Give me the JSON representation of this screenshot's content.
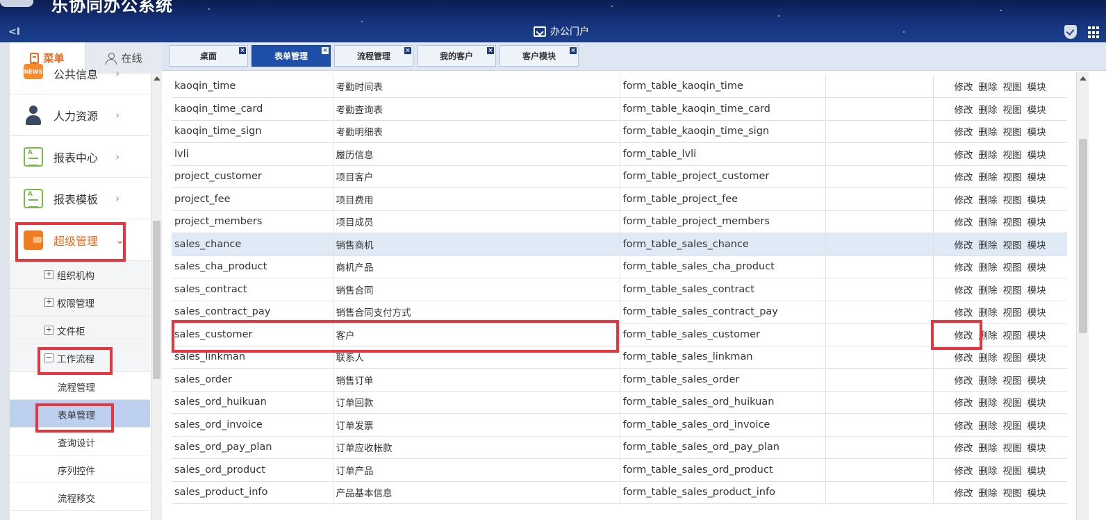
{
  "header": {
    "app_title": "乐协同办公系统",
    "portal_label": "办公门户",
    "collapse_glyph": "<I"
  },
  "sidebar": {
    "tabs": [
      {
        "label": "菜单",
        "icon": "document-icon",
        "active": true
      },
      {
        "label": "在线",
        "icon": "user-icon",
        "active": false
      }
    ],
    "menu_items": [
      {
        "label": "公共信息",
        "icon": "news-icon",
        "icon_text": "NEWS"
      },
      {
        "label": "人力资源",
        "icon": "person-icon"
      },
      {
        "label": "报表中心",
        "icon": "report-icon"
      },
      {
        "label": "报表模板",
        "icon": "report-icon"
      },
      {
        "label": "超级管理",
        "icon": "wallet-icon",
        "active": true
      }
    ],
    "chevron_right": "›",
    "chevron_down": "⌄",
    "sub_items": [
      {
        "label": "组织机构",
        "toggle": "+"
      },
      {
        "label": "权限管理",
        "toggle": "+"
      },
      {
        "label": "文件柜",
        "toggle": "+"
      },
      {
        "label": "工作流程",
        "toggle": "−"
      }
    ],
    "leaf_items": [
      {
        "label": "流程管理"
      },
      {
        "label": "表单管理",
        "selected": true
      },
      {
        "label": "查询设计"
      },
      {
        "label": "序列控件"
      },
      {
        "label": "流程移交"
      }
    ]
  },
  "tabs": [
    {
      "label": "桌面",
      "active": false
    },
    {
      "label": "表单管理",
      "active": true
    },
    {
      "label": "流程管理",
      "active": false
    },
    {
      "label": "我的客户",
      "active": false
    },
    {
      "label": "客户模块",
      "active": false
    }
  ],
  "tab_close_glyph": "×",
  "table": {
    "actions": [
      "修改",
      "删除",
      "视图",
      "模块"
    ],
    "rows": [
      [
        "kaoqin_time",
        "考勤时间表",
        "form_table_kaoqin_time",
        ""
      ],
      [
        "kaoqin_time_card",
        "考勤查询表",
        "form_table_kaoqin_time_card",
        ""
      ],
      [
        "kaoqin_time_sign",
        "考勤明细表",
        "form_table_kaoqin_time_sign",
        ""
      ],
      [
        "lvli",
        "履历信息",
        "form_table_lvli",
        ""
      ],
      [
        "project_customer",
        "项目客户",
        "form_table_project_customer",
        ""
      ],
      [
        "project_fee",
        "项目费用",
        "form_table_project_fee",
        ""
      ],
      [
        "project_members",
        "项目成员",
        "form_table_project_members",
        ""
      ],
      [
        "sales_chance",
        "销售商机",
        "form_table_sales_chance",
        ""
      ],
      [
        "sales_cha_product",
        "商机产品",
        "form_table_sales_cha_product",
        ""
      ],
      [
        "sales_contract",
        "销售合同",
        "form_table_sales_contract",
        ""
      ],
      [
        "sales_contract_pay",
        "销售合同支付方式",
        "form_table_sales_contract_pay",
        ""
      ],
      [
        "sales_customer",
        "客户",
        "form_table_sales_customer",
        ""
      ],
      [
        "sales_linkman",
        "联系人",
        "form_table_sales_linkman",
        ""
      ],
      [
        "sales_order",
        "销售订单",
        "form_table_sales_order",
        ""
      ],
      [
        "sales_ord_huikuan",
        "订单回款",
        "form_table_sales_ord_huikuan",
        ""
      ],
      [
        "sales_ord_invoice",
        "订单发票",
        "form_table_sales_ord_invoice",
        ""
      ],
      [
        "sales_ord_pay_plan",
        "订单应收帐款",
        "form_table_sales_ord_pay_plan",
        ""
      ],
      [
        "sales_ord_product",
        "订单产品",
        "form_table_sales_ord_product",
        ""
      ],
      [
        "sales_product_info",
        "产品基本信息",
        "form_table_sales_product_info",
        ""
      ]
    ],
    "highlighted_row": "sales_chance"
  },
  "colors": {
    "accent": "#e86a1e",
    "header_bg": "#16347c",
    "active_tab": "#1e4fa8",
    "selected_leaf": "#bed0ef",
    "row_highlight": "#dfeaf6",
    "annotation_red": "#e8353d"
  }
}
